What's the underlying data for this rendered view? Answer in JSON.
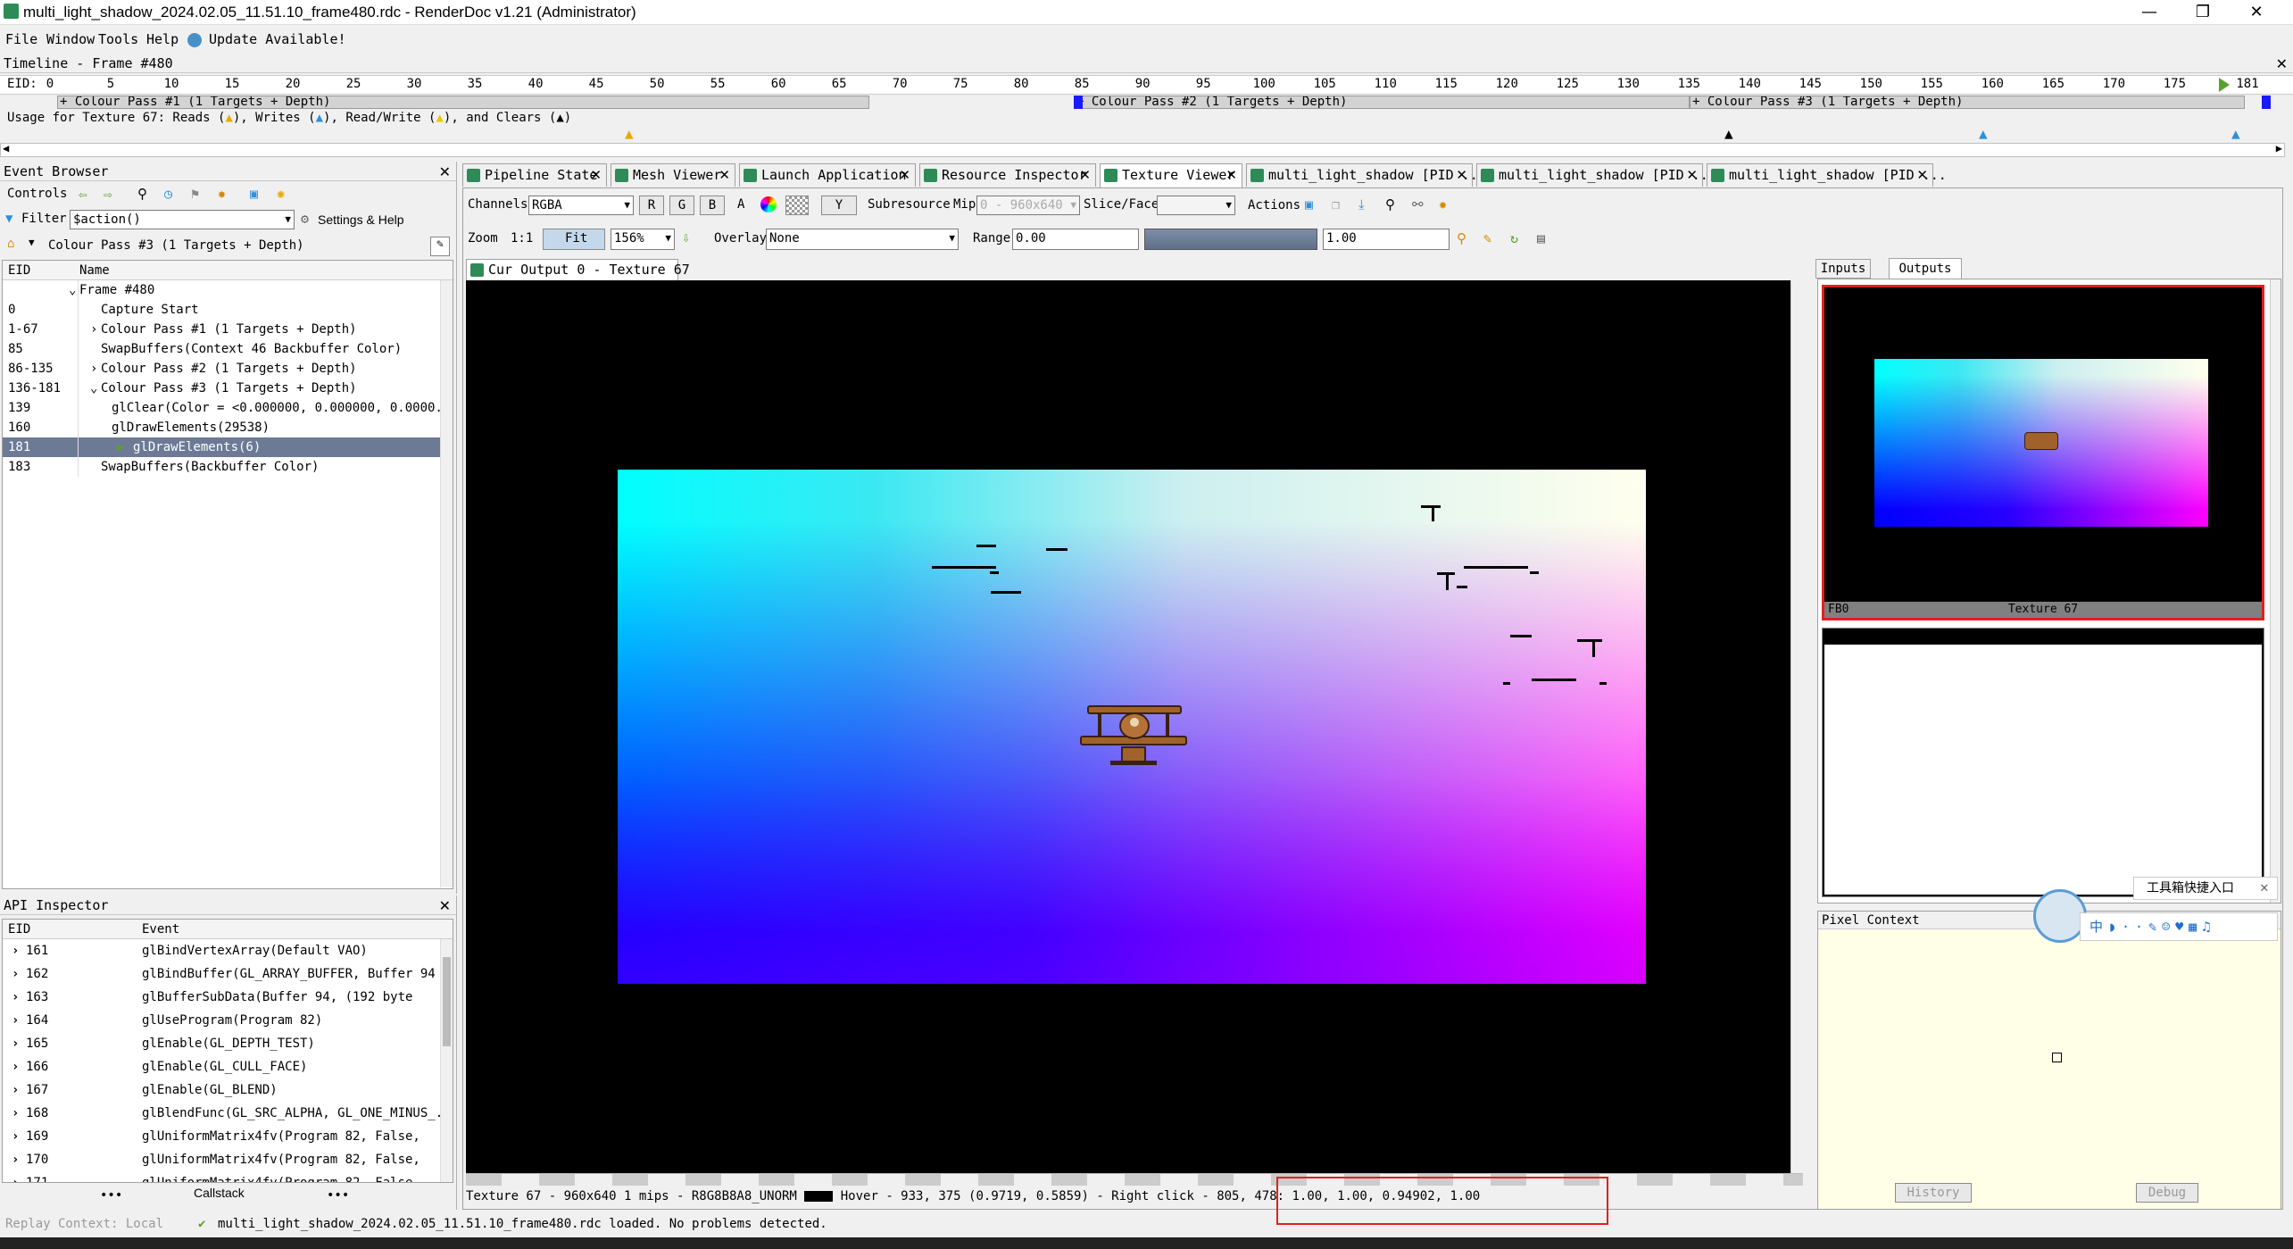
{
  "window": {
    "title": "multi_light_shadow_2024.02.05_11.51.10_frame480.rdc - RenderDoc v1.21 (Administrator)",
    "min": "—",
    "max": "❐",
    "close": "✕"
  },
  "menu": {
    "file": "File",
    "window": "Window",
    "tools": "Tools",
    "help": "Help",
    "update": "Update Available!"
  },
  "timeline": {
    "header": "Timeline - Frame #480",
    "eid_label": "EID:",
    "ticks": [
      "0",
      "5",
      "10",
      "15",
      "20",
      "25",
      "30",
      "35",
      "40",
      "45",
      "50",
      "55",
      "60",
      "65",
      "70",
      "75",
      "80",
      "85",
      "90",
      "95",
      "100",
      "105",
      "110",
      "115",
      "120",
      "125",
      "130",
      "135",
      "140",
      "145",
      "150",
      "155",
      "160",
      "165",
      "170",
      "175",
      "181"
    ],
    "passes": [
      "+ Colour Pass #1 (1 Targets + Depth)",
      "+ Colour Pass #2 (1 Targets + Depth)",
      "+ Colour Pass #3 (1 Targets + Depth)"
    ],
    "usage": {
      "prefix": "Usage for Texture 67: Reads (",
      "writes": "), Writes (",
      "rw": "), Read/Write (",
      "clears": "), and Clears (",
      "end": ")"
    }
  },
  "event_browser": {
    "title": "Event Browser",
    "controls_label": "Controls",
    "filter_label": "Filter",
    "filter_value": "$action()",
    "settings_label": "Settings & Help",
    "breadcrumb": "Colour Pass #3 (1 Targets + Depth)",
    "col_eid": "EID",
    "col_name": "Name",
    "rows": [
      {
        "eid": "",
        "name": "Frame #480"
      },
      {
        "eid": "0",
        "name": "Capture Start"
      },
      {
        "eid": "1-67",
        "name": "Colour Pass #1 (1 Targets + Depth)"
      },
      {
        "eid": "85",
        "name": "SwapBuffers(Context 46 Backbuffer Color)"
      },
      {
        "eid": "86-135",
        "name": "Colour Pass #2 (1 Targets + Depth)"
      },
      {
        "eid": "136-181",
        "name": "Colour Pass #3 (1 Targets + Depth)"
      },
      {
        "eid": "139",
        "name": "glClear(Color = <0.000000, 0.000000, 0.0000..."
      },
      {
        "eid": "160",
        "name": "glDrawElements(29538)"
      },
      {
        "eid": "181",
        "name": "glDrawElements(6)"
      },
      {
        "eid": "183",
        "name": "SwapBuffers(Backbuffer Color)"
      }
    ]
  },
  "api_inspector": {
    "title": "API Inspector",
    "col_eid": "EID",
    "col_event": "Event",
    "rows": [
      {
        "eid": "161",
        "event": "glBindVertexArray(Default VAO)"
      },
      {
        "eid": "162",
        "event": "glBindBuffer(GL_ARRAY_BUFFER, Buffer 94"
      },
      {
        "eid": "163",
        "event": "glBufferSubData(Buffer 94, (192 byte"
      },
      {
        "eid": "164",
        "event": "glUseProgram(Program 82)"
      },
      {
        "eid": "165",
        "event": "glEnable(GL_DEPTH_TEST)"
      },
      {
        "eid": "166",
        "event": "glEnable(GL_CULL_FACE)"
      },
      {
        "eid": "167",
        "event": "glEnable(GL_BLEND)"
      },
      {
        "eid": "168",
        "event": "glBlendFunc(GL_SRC_ALPHA, GL_ONE_MINUS_..."
      },
      {
        "eid": "169",
        "event": "glUniformMatrix4fv(Program 82, False,"
      },
      {
        "eid": "170",
        "event": "glUniformMatrix4fv(Program 82, False,"
      },
      {
        "eid": "171",
        "event": "glUniformMatrix4fv(Program 82, False,"
      }
    ],
    "callstack": "Callstack",
    "dots": "•••"
  },
  "tabs": [
    "Pipeline State",
    "Mesh Viewer",
    "Launch Application",
    "Resource Inspector",
    "Texture Viewer",
    "multi_light_shadow [PID ...",
    "multi_light_shadow [PID ...",
    "multi_light_shadow [PID ..."
  ],
  "texture_viewer": {
    "channels_label": "Channels",
    "channels_value": "RGBA",
    "r": "R",
    "g": "G",
    "b": "B",
    "a": "A",
    "y": "Y",
    "subresource_label": "Subresource",
    "mip_label": "Mip",
    "mip_value": "0 - 960x640",
    "slice_label": "Slice/Face",
    "actions_label": "Actions",
    "zoom_label": "Zoom",
    "zoom_11": "1:1",
    "fit": "Fit",
    "zoom_value": "156%",
    "overlay_label": "Overlay",
    "overlay_value": "None",
    "range_label": "Range",
    "range_min": "0.00",
    "range_max": "1.00",
    "output_tab": "Cur Output 0 - Texture 67",
    "status": "Texture 67 - 960x640 1 mips - R8G8B8A8_UNORM",
    "hover": "Hover -   933,  375 (0.9719, 0.5859)  - Right click -",
    "picked": "805,  478: 1.00, 1.00, 0.94902, 1.00"
  },
  "side": {
    "inputs_tab": "Inputs",
    "outputs_tab": "Outputs",
    "thumb1_left": "FB0",
    "thumb1_label": "Texture 67",
    "pixel_context": "Pixel Context",
    "history": "History",
    "debug": "Debug",
    "toolbox_label": "工具箱快捷入口"
  },
  "status": {
    "replay": "Replay Context: Local",
    "message": "multi_light_shadow_2024.02.05_11.51.10_frame480.rdc loaded. No problems detected."
  },
  "colors": {
    "accent_red": "#e02020",
    "selection": "#6c7a96",
    "icon_green": "#2e8b57"
  }
}
